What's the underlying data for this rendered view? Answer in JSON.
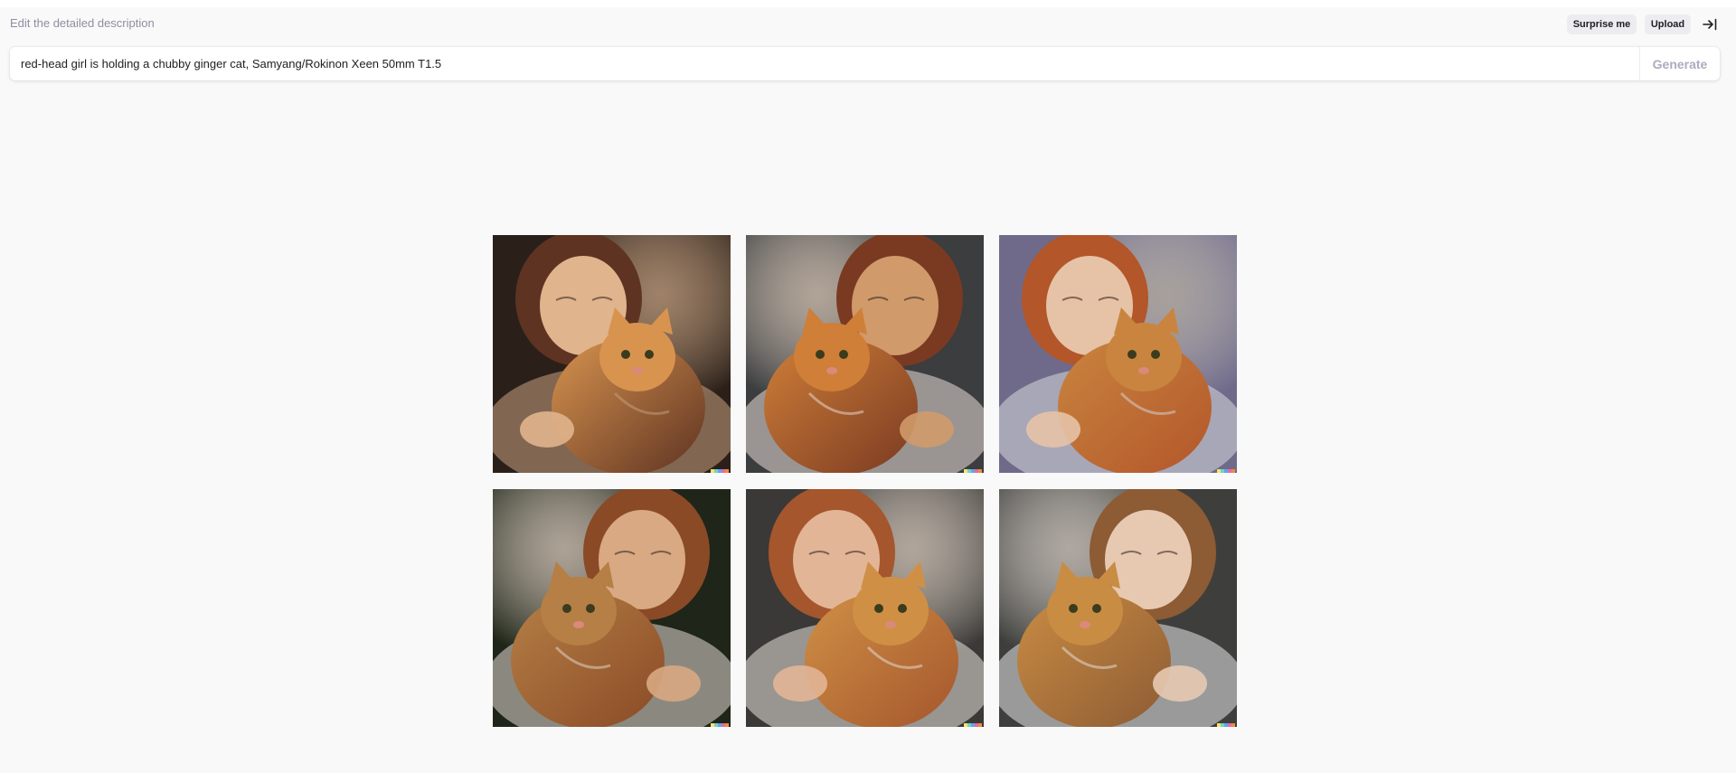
{
  "header": {
    "hint": "Edit the detailed description",
    "surprise_label": "Surprise me",
    "upload_label": "Upload"
  },
  "prompt": {
    "value": "red-head girl is holding a chubby ginger cat, Samyang/Rokinon Xeen 50mm T1.5",
    "generate_label": "Generate"
  },
  "icons": {
    "collapse": "arrow-right-to-bar-icon"
  },
  "colors": {
    "page_bg": "#f9f9fa",
    "button_bg": "#ececf1",
    "generate_disabled": "#acacbe",
    "hint_text": "#8e8ea0"
  },
  "results": {
    "count": 6,
    "images": [
      {
        "label": "girl with dark hair hugging ginger cat, warm window light",
        "palette": [
          "#2a2019",
          "#e0b48d",
          "#d8944f",
          "#5e3322",
          "#c8a182"
        ]
      },
      {
        "label": "girl with auburn hair holding ginger cat up",
        "palette": [
          "#3b3d3f",
          "#d09a6a",
          "#cf7f38",
          "#7a3a22",
          "#e9dfd7"
        ]
      },
      {
        "label": "red-haired girl in striped shirt hugging cat, blue curtain",
        "palette": [
          "#6f6a8a",
          "#e6c3a7",
          "#c9853f",
          "#b3562a",
          "#d7d8de"
        ]
      },
      {
        "label": "girl with glasses cuddling ginger cat, dark background",
        "palette": [
          "#1f2518",
          "#d8a982",
          "#b57f45",
          "#8a4a26",
          "#e3dcd5"
        ]
      },
      {
        "label": "red-haired girl cheek to cheek with ginger cat",
        "palette": [
          "#3a3937",
          "#e2b596",
          "#cf9046",
          "#a5562c",
          "#e8e2dd"
        ]
      },
      {
        "label": "girl with bob haircut holding tabby ginger cat",
        "palette": [
          "#3e3f3c",
          "#e7c9b2",
          "#c98c43",
          "#8d5b34",
          "#e6e6e8"
        ]
      }
    ]
  }
}
